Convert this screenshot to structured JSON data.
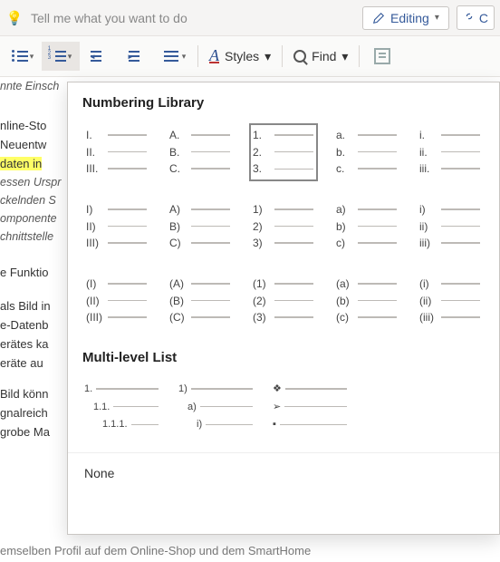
{
  "ribbon": {
    "tellme_placeholder": "Tell me what you want to do",
    "editing_label": "Editing",
    "right_button_label": "C",
    "styles_label": "Styles",
    "find_label": "Find"
  },
  "popup": {
    "title_library": "Numbering Library",
    "title_multi": "Multi-level List",
    "none_label": "None",
    "options": [
      {
        "id": "roman-upper-dot",
        "labels": [
          "I.",
          "II.",
          "III."
        ],
        "selected": false
      },
      {
        "id": "alpha-upper-dot",
        "labels": [
          "A.",
          "B.",
          "C."
        ],
        "selected": false
      },
      {
        "id": "decimal-dot",
        "labels": [
          "1.",
          "2.",
          "3."
        ],
        "selected": true
      },
      {
        "id": "alpha-lower-dot",
        "labels": [
          "a.",
          "b.",
          "c."
        ],
        "selected": false
      },
      {
        "id": "roman-lower-dot",
        "labels": [
          "i.",
          "ii.",
          "iii."
        ],
        "selected": false
      },
      {
        "id": "roman-upper-paren",
        "labels": [
          "I)",
          "II)",
          "III)"
        ],
        "selected": false
      },
      {
        "id": "alpha-upper-paren",
        "labels": [
          "A)",
          "B)",
          "C)"
        ],
        "selected": false
      },
      {
        "id": "decimal-paren",
        "labels": [
          "1)",
          "2)",
          "3)"
        ],
        "selected": false
      },
      {
        "id": "alpha-lower-paren",
        "labels": [
          "a)",
          "b)",
          "c)"
        ],
        "selected": false
      },
      {
        "id": "roman-lower-paren",
        "labels": [
          "i)",
          "ii)",
          "iii)"
        ],
        "selected": false
      },
      {
        "id": "roman-upper-parens",
        "labels": [
          "(I)",
          "(II)",
          "(III)"
        ],
        "selected": false
      },
      {
        "id": "alpha-upper-parens",
        "labels": [
          "(A)",
          "(B)",
          "(C)"
        ],
        "selected": false
      },
      {
        "id": "decimal-parens",
        "labels": [
          "(1)",
          "(2)",
          "(3)"
        ],
        "selected": false
      },
      {
        "id": "alpha-lower-parens",
        "labels": [
          "(a)",
          "(b)",
          "(c)"
        ],
        "selected": false
      },
      {
        "id": "roman-lower-parens",
        "labels": [
          "(i)",
          "(ii)",
          "(iii)"
        ],
        "selected": false
      }
    ],
    "multilevel": [
      {
        "id": "ml-decimal",
        "labels": [
          "1.",
          "1.1.",
          "1.1.1."
        ],
        "indent": true,
        "bullets": false
      },
      {
        "id": "ml-mixed",
        "labels": [
          "1)",
          "a)",
          "i)"
        ],
        "indent": true,
        "bullets": false
      },
      {
        "id": "ml-bullets",
        "labels": [
          "❖",
          "➢",
          "▪"
        ],
        "indent": false,
        "bullets": true
      }
    ]
  },
  "document_fragments": {
    "l1": "nnte Einsch",
    "l2": "nline-Sto",
    "l3": "Neuentw",
    "l4": "daten in",
    "l5": "essen Urspr",
    "l6": "ckelnden S",
    "l7": "omponente",
    "l8": "chnittstelle",
    "l9": "e Funktio",
    "l10": "als Bild in",
    "l11": "e-Datenb",
    "l12": "erätes ka",
    "l13": "eräte au",
    "l14": "Bild könn",
    "l15": "gnalreich",
    "l16": "grobe Ma",
    "bottom": "emselben Profil auf dem Online-Shop und dem SmartHome"
  }
}
